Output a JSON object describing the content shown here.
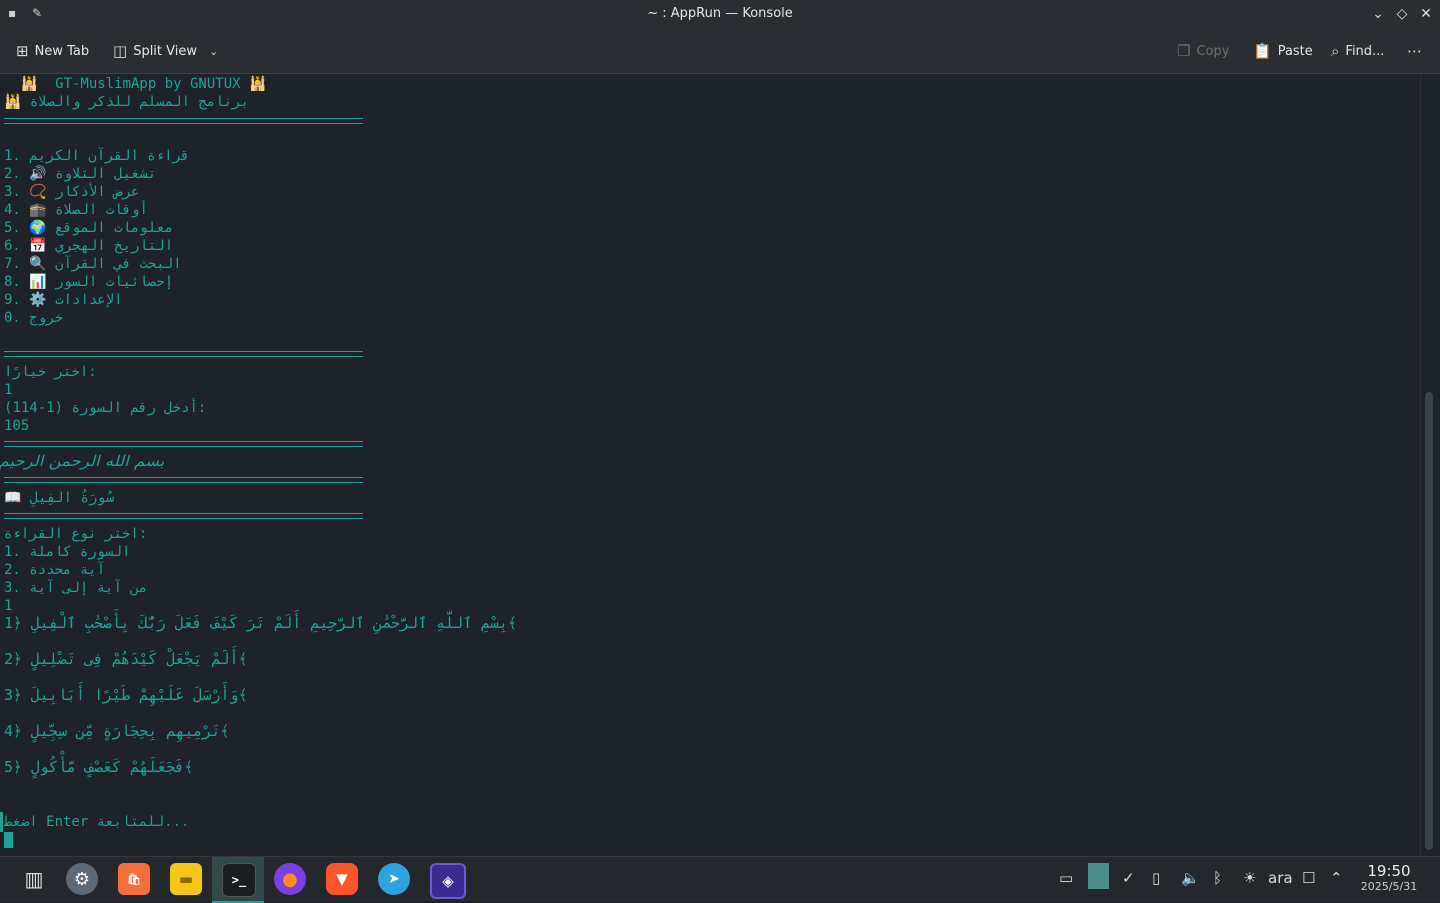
{
  "window": {
    "title": "~ : AppRun — Konsole",
    "app_icon": "konsole-icon",
    "pin_icon": "pin-icon"
  },
  "toolbar": {
    "new_tab": "New Tab",
    "split_view": "Split View",
    "copy": "Copy",
    "paste": "Paste",
    "find": "Find..."
  },
  "terminal": {
    "header_en": "  🕌  GT-MuslimApp by GNUTUX 🕌",
    "header_ar": "🕌 برنامج المسلم للذكر والصلاة",
    "menu": [
      "1. قراءة القرآن الكريم",
      "2. 🔊 تشغيل التلاوة",
      "3. 📿 عرض الأذكار",
      "4. 🕋 أوقات الصلاة",
      "5. 🌍 معلومات الموقع",
      "6. 📅 التاريخ الهجري",
      "7. 🔍 البحث في القرآن",
      "8. 📊 إحصائيات السور",
      "9. ⚙️ الإعدادات",
      "0. خروج"
    ],
    "prompt_choice": "اختر خيارًا:",
    "input_choice": "1",
    "prompt_surah": "أدخل رقم السورة (1-114):",
    "input_surah": "105",
    "basmala": "بسم الله الرحمن الرحيم",
    "surah_title": "📖 سُورَةُ الفِيلِ",
    "reading_prompt": "اختر نوع القراءة:",
    "reading_options": [
      "1. السورة كاملة",
      "2. آية محددة",
      "3. من آية إلى آية"
    ],
    "reading_input": "1",
    "verses": [
      "بِسْمِ ٱللَّهِ ٱلرَّحْمَٰنِ ٱلرَّحِيمِ أَلَمْ تَرَ كَيْفَ فَعَلَ رَبُّكَ بِأَصْحَٰبِ ٱلْفِيلِ ﴿1﴾",
      "أَلَمْ يَجْعَلْ كَيْدَهُمْ فِى تَضْلِيلٍ ﴿2﴾",
      "وَأَرْسَلَ عَلَيْهِمْ طَيْرًا أَبَابِيلَ ﴿3﴾",
      "تَرْمِيهِم بِحِجَارَةٍ مِّن سِجِّيلٍ ﴿4﴾",
      "فَجَعَلَهُمْ كَعَصْفٍ مَّأْكُولٍ ﴿5﴾"
    ],
    "continue_prompt": "اضغط Enter للمتابعة..."
  },
  "taskbar": {
    "apps": [
      {
        "name": "app-launcher-icon"
      },
      {
        "name": "system-settings-icon"
      },
      {
        "name": "software-store-icon"
      },
      {
        "name": "file-manager-icon"
      },
      {
        "name": "konsole-icon"
      },
      {
        "name": "firefox-icon"
      },
      {
        "name": "brave-icon"
      },
      {
        "name": "telegram-icon"
      },
      {
        "name": "screenshot-app-icon"
      }
    ],
    "keyboard_layout": "ara",
    "clock_time": "19:50",
    "clock_date": "2025/5/31"
  },
  "colors": {
    "terminal_text": "#1fa396",
    "terminal_bg": "#1e2229",
    "chrome_bg": "#2a2e32"
  }
}
